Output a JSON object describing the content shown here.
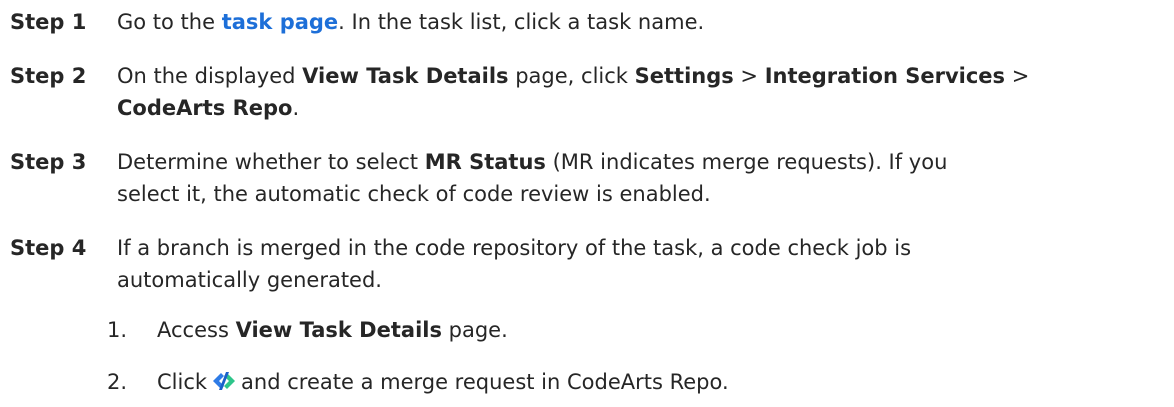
{
  "steps": [
    {
      "label": "Step 1",
      "t1": "Go to the ",
      "link": "task page",
      "t2": ". In the task list, click a task name."
    },
    {
      "label": "Step 2",
      "t1": "On the displayed ",
      "b1": "View Task Details",
      "t2": " page, click ",
      "b2": "Settings",
      "t3": " > ",
      "b3": "Integration Services",
      "t4": " > ",
      "b4": "CodeArts Repo",
      "t5": "."
    },
    {
      "label": "Step 3",
      "t1": "Determine whether to select ",
      "b1": "MR Status",
      "t2": " (MR indicates merge requests). If you",
      "line2": "select it, the automatic check of code review is enabled."
    },
    {
      "label": "Step 4",
      "line1": "If a branch is merged in the code repository of the task, a code check job is",
      "line2": "automatically generated."
    }
  ],
  "substeps": [
    {
      "num": "1.",
      "t1": "Access ",
      "b1": "View Task Details",
      "t2": " page."
    },
    {
      "num": "2.",
      "t1": "Click",
      "icon": "codearts-repo-icon",
      "t2": "and create a merge request in CodeArts Repo."
    }
  ],
  "colors": {
    "link": "#1d6fd8",
    "text": "#262626",
    "icon_blue": "#2e7be6",
    "icon_green": "#2ec58a"
  }
}
